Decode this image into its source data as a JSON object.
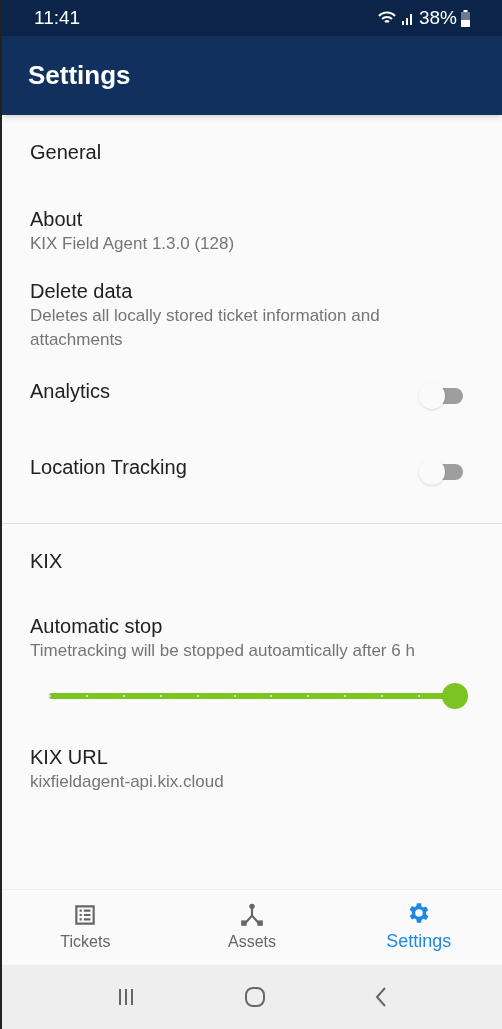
{
  "status_bar": {
    "time": "11:41",
    "battery": "38%"
  },
  "app_bar": {
    "title": "Settings"
  },
  "sections": [
    {
      "title": "General",
      "items": [
        {
          "kind": "info",
          "title": "About",
          "subtitle": "KIX Field Agent 1.3.0 (128)"
        },
        {
          "kind": "info",
          "title": "Delete data",
          "subtitle": "Deletes all locally stored ticket information and attachments"
        },
        {
          "kind": "toggle",
          "title": "Analytics",
          "on": false
        },
        {
          "kind": "toggle",
          "title": "Location Tracking",
          "on": false
        }
      ]
    },
    {
      "title": "KIX",
      "items": [
        {
          "kind": "slider",
          "title": "Automatic stop",
          "subtitle": "Timetracking will be stopped autoamtically after 6 h",
          "level": 1
        },
        {
          "kind": "info",
          "title": "KIX URL",
          "subtitle": "kixfieldagent-api.kix.cloud"
        }
      ]
    }
  ],
  "bottom_nav": [
    {
      "label": "Tickets",
      "selected": false
    },
    {
      "label": "Assets",
      "selected": false
    },
    {
      "label": "Settings",
      "selected": true
    }
  ]
}
